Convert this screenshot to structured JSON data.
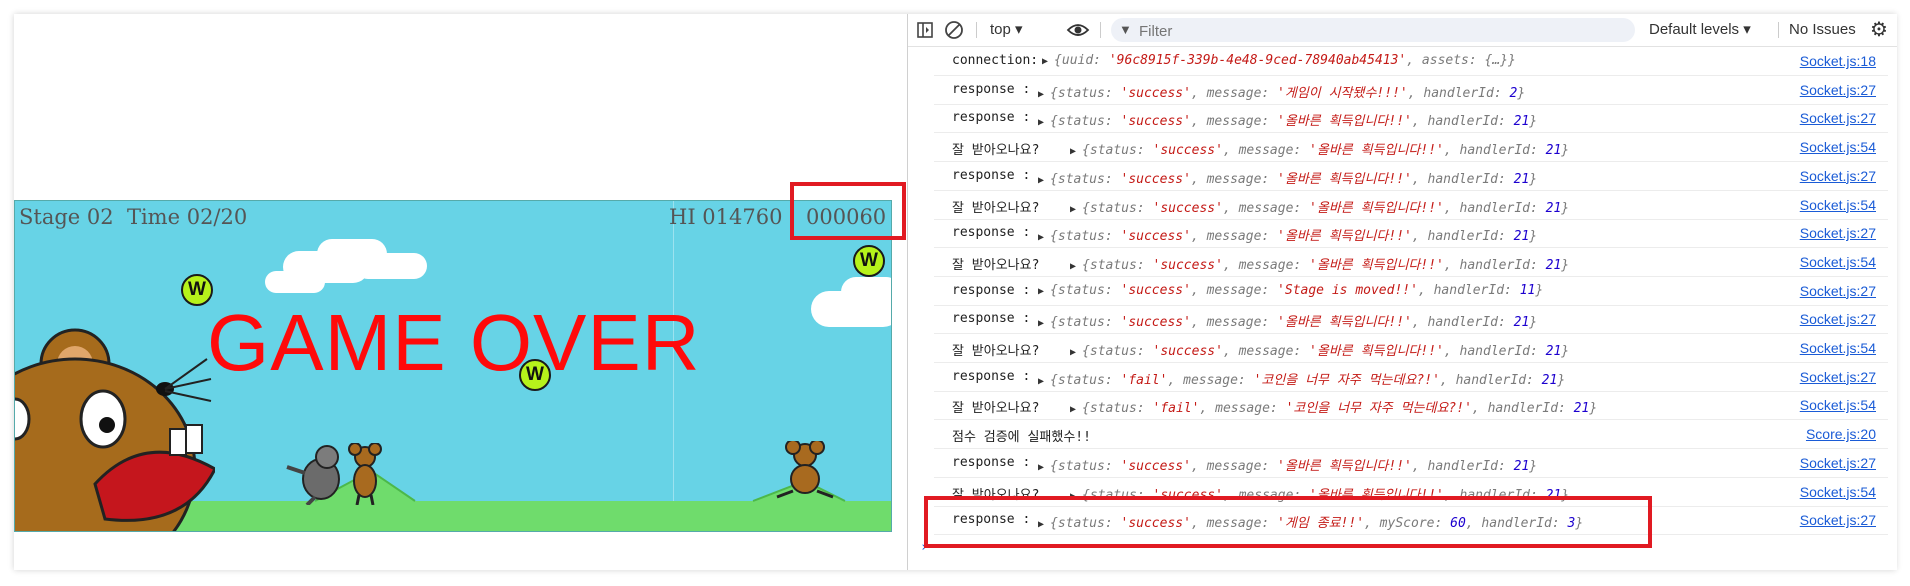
{
  "game": {
    "stage_text": "Stage 02  Time 02/20",
    "hi_text": "HI 014760",
    "score_text": "000060",
    "game_over": "GAME OVER",
    "coin_letter": "W"
  },
  "devtools": {
    "context": "top",
    "filter_placeholder": "Filter",
    "levels": "Default levels",
    "issues": "No Issues",
    "logs": [
      {
        "label": "connection:",
        "obj": [
          [
            "{uuid: ",
            "k"
          ],
          [
            "'96c8915f-339b-4e48-9ced-78940ab45413'",
            "s"
          ],
          [
            ", assets: {…}}",
            "k"
          ]
        ],
        "src": "Socket.js:18"
      },
      {
        "label": "response :",
        "obj": [
          [
            "{status: ",
            "k"
          ],
          [
            "'success'",
            "s"
          ],
          [
            ", message: ",
            "k"
          ],
          [
            "'게임이 시작됐수!!!'",
            "s"
          ],
          [
            ", handlerId: ",
            "k"
          ],
          [
            "2",
            "n"
          ],
          [
            "}",
            "k"
          ]
        ],
        "src": "Socket.js:27"
      },
      {
        "label": "response :",
        "obj": [
          [
            "{status: ",
            "k"
          ],
          [
            "'success'",
            "s"
          ],
          [
            ", message: ",
            "k"
          ],
          [
            "'올바른 획득입니다!!'",
            "s"
          ],
          [
            ", handlerId: ",
            "k"
          ],
          [
            "21",
            "n"
          ],
          [
            "}",
            "k"
          ]
        ],
        "src": "Socket.js:27"
      },
      {
        "label": "잘 받아오나요?",
        "obj": [
          [
            "{status: ",
            "k"
          ],
          [
            "'success'",
            "s"
          ],
          [
            ", message: ",
            "k"
          ],
          [
            "'올바른 획득입니다!!'",
            "s"
          ],
          [
            ", handlerId: ",
            "k"
          ],
          [
            "21",
            "n"
          ],
          [
            "}",
            "k"
          ]
        ],
        "src": "Socket.js:54"
      },
      {
        "label": "response :",
        "obj": [
          [
            "{status: ",
            "k"
          ],
          [
            "'success'",
            "s"
          ],
          [
            ", message: ",
            "k"
          ],
          [
            "'올바른 획득입니다!!'",
            "s"
          ],
          [
            ", handlerId: ",
            "k"
          ],
          [
            "21",
            "n"
          ],
          [
            "}",
            "k"
          ]
        ],
        "src": "Socket.js:27"
      },
      {
        "label": "잘 받아오나요?",
        "obj": [
          [
            "{status: ",
            "k"
          ],
          [
            "'success'",
            "s"
          ],
          [
            ", message: ",
            "k"
          ],
          [
            "'올바른 획득입니다!!'",
            "s"
          ],
          [
            ", handlerId: ",
            "k"
          ],
          [
            "21",
            "n"
          ],
          [
            "}",
            "k"
          ]
        ],
        "src": "Socket.js:54"
      },
      {
        "label": "response :",
        "obj": [
          [
            "{status: ",
            "k"
          ],
          [
            "'success'",
            "s"
          ],
          [
            ", message: ",
            "k"
          ],
          [
            "'올바른 획득입니다!!'",
            "s"
          ],
          [
            ", handlerId: ",
            "k"
          ],
          [
            "21",
            "n"
          ],
          [
            "}",
            "k"
          ]
        ],
        "src": "Socket.js:27"
      },
      {
        "label": "잘 받아오나요?",
        "obj": [
          [
            "{status: ",
            "k"
          ],
          [
            "'success'",
            "s"
          ],
          [
            ", message: ",
            "k"
          ],
          [
            "'올바른 획득입니다!!'",
            "s"
          ],
          [
            ", handlerId: ",
            "k"
          ],
          [
            "21",
            "n"
          ],
          [
            "}",
            "k"
          ]
        ],
        "src": "Socket.js:54"
      },
      {
        "label": "response :",
        "obj": [
          [
            "{status: ",
            "k"
          ],
          [
            "'success'",
            "s"
          ],
          [
            ", message: ",
            "k"
          ],
          [
            "'Stage is moved!!'",
            "s"
          ],
          [
            ", handlerId: ",
            "k"
          ],
          [
            "11",
            "n"
          ],
          [
            "}",
            "k"
          ]
        ],
        "src": "Socket.js:27"
      },
      {
        "label": "response :",
        "obj": [
          [
            "{status: ",
            "k"
          ],
          [
            "'success'",
            "s"
          ],
          [
            ", message: ",
            "k"
          ],
          [
            "'올바른 획득입니다!!'",
            "s"
          ],
          [
            ", handlerId: ",
            "k"
          ],
          [
            "21",
            "n"
          ],
          [
            "}",
            "k"
          ]
        ],
        "src": "Socket.js:27"
      },
      {
        "label": "잘 받아오나요?",
        "obj": [
          [
            "{status: ",
            "k"
          ],
          [
            "'success'",
            "s"
          ],
          [
            ", message: ",
            "k"
          ],
          [
            "'올바른 획득입니다!!'",
            "s"
          ],
          [
            ", handlerId: ",
            "k"
          ],
          [
            "21",
            "n"
          ],
          [
            "}",
            "k"
          ]
        ],
        "src": "Socket.js:54"
      },
      {
        "label": "response :",
        "obj": [
          [
            "{status: ",
            "k"
          ],
          [
            "'fail'",
            "s"
          ],
          [
            ", message: ",
            "k"
          ],
          [
            "'코인을 너무 자주 먹는데요?!'",
            "s"
          ],
          [
            ", handlerId: ",
            "k"
          ],
          [
            "21",
            "n"
          ],
          [
            "}",
            "k"
          ]
        ],
        "src": "Socket.js:27"
      },
      {
        "label": "잘 받아오나요?",
        "obj": [
          [
            "{status: ",
            "k"
          ],
          [
            "'fail'",
            "s"
          ],
          [
            ", message: ",
            "k"
          ],
          [
            "'코인을 너무 자주 먹는데요?!'",
            "s"
          ],
          [
            ", handlerId: ",
            "k"
          ],
          [
            "21",
            "n"
          ],
          [
            "}",
            "k"
          ]
        ],
        "src": "Socket.js:54"
      },
      {
        "label": "점수 검증에 실패했수!!",
        "obj": [],
        "src": "Score.js:20"
      },
      {
        "label": "response :",
        "obj": [
          [
            "{status: ",
            "k"
          ],
          [
            "'success'",
            "s"
          ],
          [
            ", message: ",
            "k"
          ],
          [
            "'올바른 획득입니다!!'",
            "s"
          ],
          [
            ", handlerId: ",
            "k"
          ],
          [
            "21",
            "n"
          ],
          [
            "}",
            "k"
          ]
        ],
        "src": "Socket.js:27"
      },
      {
        "label": "잘 받아오나요?",
        "obj": [
          [
            "{status: ",
            "k"
          ],
          [
            "'success'",
            "s"
          ],
          [
            ", message: ",
            "k"
          ],
          [
            "'올바른 획득입니다!!'",
            "s"
          ],
          [
            ", handlerId: ",
            "k"
          ],
          [
            "21",
            "n"
          ],
          [
            "}",
            "k"
          ]
        ],
        "src": "Socket.js:54"
      },
      {
        "label": "response :",
        "obj": [
          [
            "{status: ",
            "k"
          ],
          [
            "'success'",
            "s"
          ],
          [
            ", message: ",
            "k"
          ],
          [
            "'게임 종료!!'",
            "s"
          ],
          [
            ", myScore: ",
            "k"
          ],
          [
            "60",
            "n"
          ],
          [
            ", handlerId: ",
            "k"
          ],
          [
            "3",
            "n"
          ],
          [
            "}",
            "k"
          ]
        ],
        "src": "Socket.js:27"
      }
    ]
  }
}
